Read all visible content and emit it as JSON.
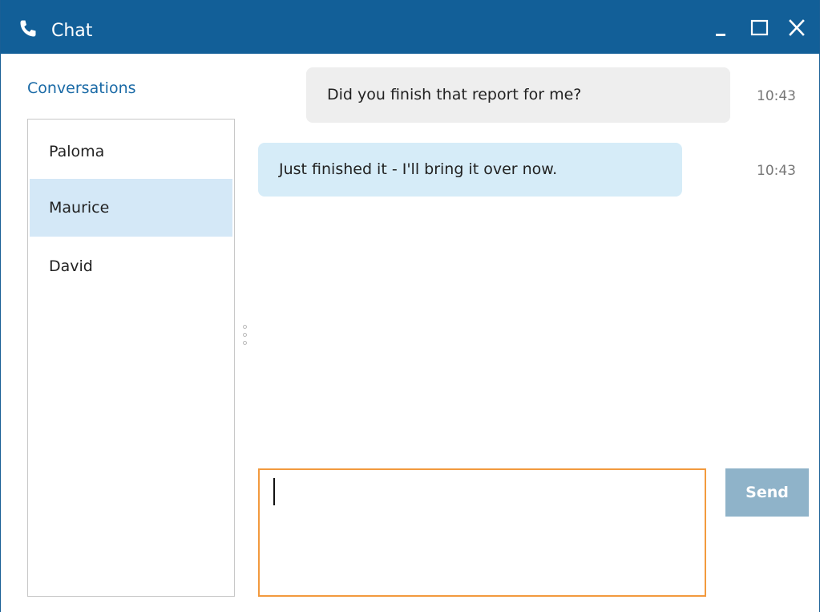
{
  "window": {
    "title": "Chat",
    "controls": {
      "minimize": "minimize",
      "maximize": "maximize",
      "close": "close"
    }
  },
  "sidebar": {
    "heading": "Conversations",
    "items": [
      {
        "label": "Paloma",
        "selected": false
      },
      {
        "label": "Maurice",
        "selected": true
      },
      {
        "label": "David",
        "selected": false
      }
    ]
  },
  "messages": [
    {
      "text": "Did you finish that report for me?",
      "time": "10:43",
      "direction": "incoming"
    },
    {
      "text": "Just finished it - I'll bring it over now.",
      "time": "10:43",
      "direction": "outgoing"
    }
  ],
  "composer": {
    "value": "",
    "send_label": "Send"
  },
  "colors": {
    "titlebar": "#125f98",
    "accent_text": "#1a6aa6",
    "selected_item": "#d4e8f7",
    "incoming_bubble": "#eeeeee",
    "outgoing_bubble": "#d6ecf8",
    "compose_border": "#f29a3e",
    "send_button": "#8fb3c9"
  }
}
